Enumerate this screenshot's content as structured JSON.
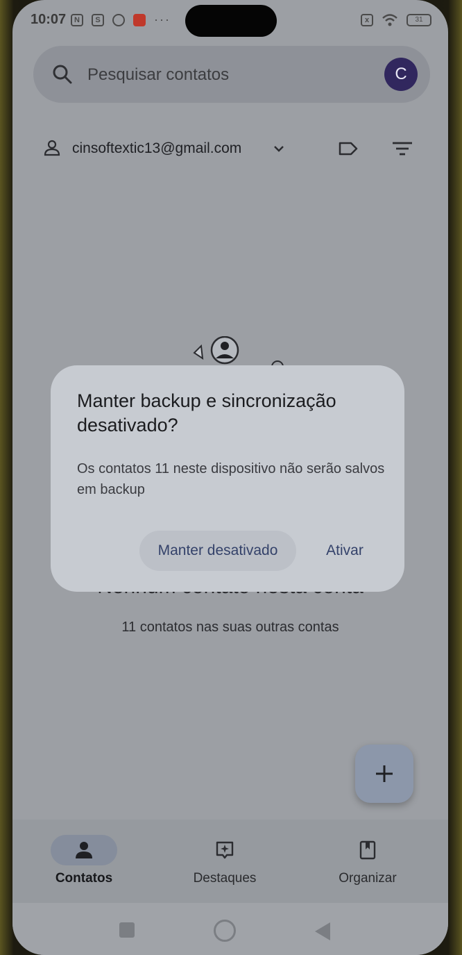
{
  "status_bar": {
    "time": "10:07",
    "battery": "31"
  },
  "search": {
    "placeholder": "Pesquisar contatos",
    "avatar_letter": "C"
  },
  "account": {
    "email": "cinsoftextic13@gmail.com"
  },
  "empty_state": {
    "title": "Nenhum contato nesta conta",
    "subtitle": "11 contatos nas suas outras contas"
  },
  "dialog": {
    "title": "Manter backup e sincronização desativado?",
    "body": "Os contatos 11 neste dispositivo não serão salvos em backup",
    "keep_off_label": "Manter desativado",
    "enable_label": "Ativar"
  },
  "bottom_nav": {
    "items": [
      {
        "label": "Contatos",
        "icon": "person-icon",
        "active": true
      },
      {
        "label": "Destaques",
        "icon": "highlights-icon",
        "active": false
      },
      {
        "label": "Organizar",
        "icon": "bookmark-icon",
        "active": false
      }
    ]
  },
  "colors": {
    "scrim": "#9c9fa4",
    "dialog_bg": "#c7cbd1",
    "accent_text": "#34426a",
    "avatar_bg": "#31275e"
  }
}
